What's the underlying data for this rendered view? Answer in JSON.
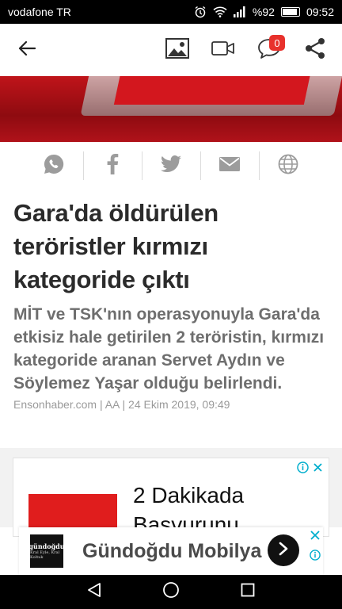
{
  "status_bar": {
    "carrier": "vodafone TR",
    "battery_level": "%92",
    "battery_fraction": 0.92,
    "time": "09:52"
  },
  "toolbar": {
    "back_icon": "arrow-left-icon",
    "gallery_icon": "image-icon",
    "video_icon": "video-icon",
    "comment_icon": "comment-icon",
    "comment_count": "0",
    "share_icon": "share-icon"
  },
  "share_bar": {
    "items": [
      "whatsapp-icon",
      "facebook-icon",
      "twitter-icon",
      "mail-icon",
      "web-icon"
    ]
  },
  "article": {
    "headline": "Gara'da öldürülen teröristler kırmızı kategoride çıktı",
    "summary": "MİT ve TSK'nın operasyonuyla Gara'da etkisiz hale getirilen 2 teröristin, kırmızı kategoride aranan Servet Aydın ve Söylemez Yaşar olduğu belirlendi.",
    "byline": "Ensonhaber.com | AA | 24 Ekim 2019, 09:49"
  },
  "ad": {
    "text": "2 Dakikada Başvurunu",
    "accent": "#e01d1d"
  },
  "banner": {
    "logo_line1": "gündoğdu",
    "logo_line2": "Kral Eyle, Kral Koltuk",
    "title": "Gündoğdu Mobilya"
  },
  "nav_bar": {
    "items": [
      "back-triangle-icon",
      "home-circle-icon",
      "recents-square-icon"
    ]
  },
  "colors": {
    "brand_red": "#e8312c",
    "headline": "#2b2b2b",
    "summary": "#6e6e6e",
    "byline": "#9a9a9a"
  }
}
